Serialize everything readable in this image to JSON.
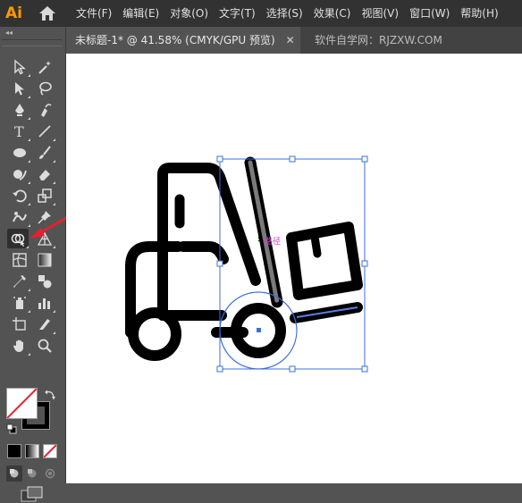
{
  "app": {
    "logo_text": "Ai",
    "logo_color": "#ff9a00"
  },
  "menu": [
    "文件(F)",
    "编辑(E)",
    "对象(O)",
    "文字(T)",
    "选择(S)",
    "效果(C)",
    "视图(V)",
    "窗口(W)",
    "帮助(H)"
  ],
  "toolbar": {
    "collapse_glyph": "◂◂",
    "tools": [
      {
        "name": "selection-tool-icon"
      },
      {
        "name": "magic-wand-tool-icon"
      },
      {
        "name": "direct-selection-tool-icon"
      },
      {
        "name": "lasso-tool-icon"
      },
      {
        "name": "pen-tool-icon"
      },
      {
        "name": "curvature-tool-icon"
      },
      {
        "name": "type-tool-icon",
        "glyph": "T"
      },
      {
        "name": "line-segment-tool-icon"
      },
      {
        "name": "ellipse-tool-icon"
      },
      {
        "name": "paintbrush-tool-icon"
      },
      {
        "name": "shaper-tool-icon"
      },
      {
        "name": "eraser-tool-icon"
      },
      {
        "name": "rotate-tool-icon"
      },
      {
        "name": "scale-tool-icon"
      },
      {
        "name": "puppet-warp-tool-icon"
      },
      {
        "name": "pin-tool-icon"
      },
      {
        "name": "shape-builder-tool-icon"
      },
      {
        "name": "perspective-grid-tool-icon"
      },
      {
        "name": "mesh-tool-icon"
      },
      {
        "name": "gradient-tool-icon"
      },
      {
        "name": "eyedropper-tool-icon"
      },
      {
        "name": "blend-tool-icon"
      },
      {
        "name": "symbol-sprayer-tool-icon"
      },
      {
        "name": "column-graph-tool-icon"
      },
      {
        "name": "artboard-tool-icon"
      },
      {
        "name": "slice-tool-icon"
      },
      {
        "name": "hand-tool-icon"
      },
      {
        "name": "zoom-tool-icon"
      }
    ],
    "active_tool": "shape-builder-tool-icon",
    "pointer_arrow_color": "#e8202a",
    "fill_color": "#ffffff",
    "stroke_color": "#000000",
    "none_slash_color": "#e8202a"
  },
  "tabs": {
    "active_title": "未标题-1* @ 41.58% (CMYK/GPU 预览)",
    "close_glyph": "✕",
    "watermark": "软件自学网：RJZXW.COM"
  },
  "canvas": {
    "selection_color": "#3b6fe0",
    "tooltip_text": "路径",
    "tooltip_color": "#d63ad0"
  }
}
